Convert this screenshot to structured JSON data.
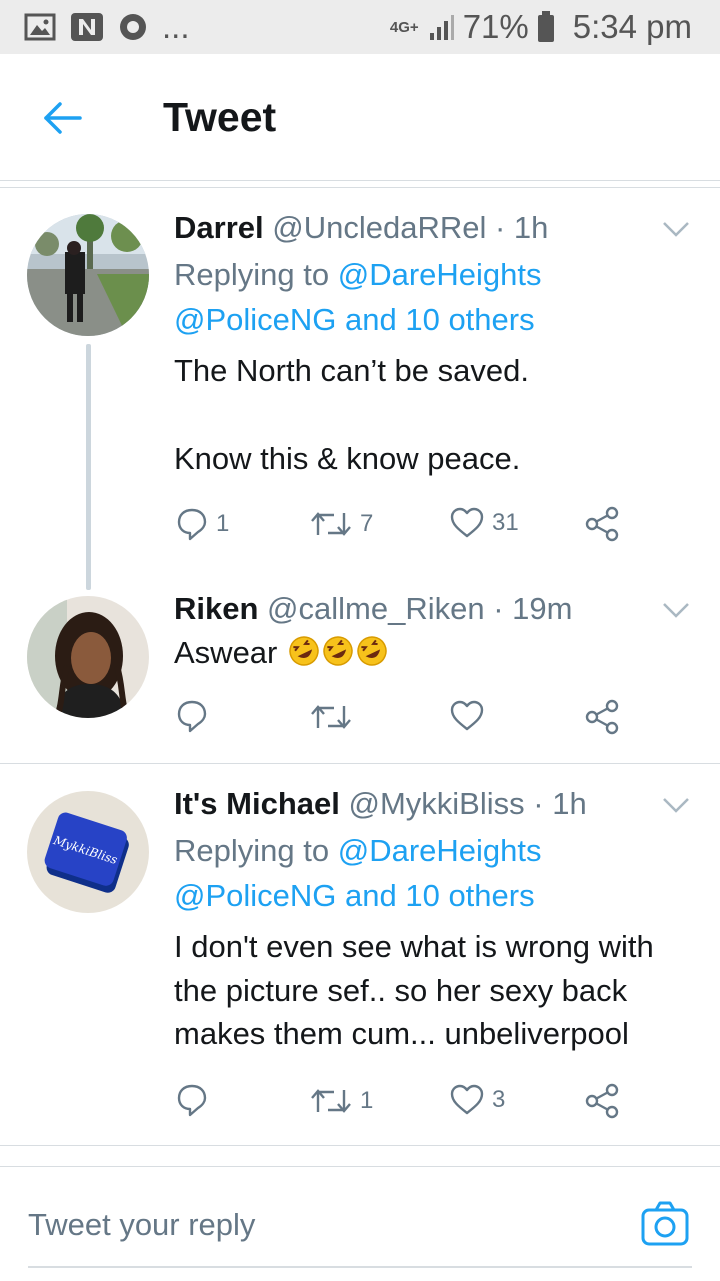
{
  "status_bar": {
    "network": "4G+",
    "battery": "71%",
    "time": "5:34 pm",
    "more": "...",
    "icons": [
      "image-icon",
      "n-app-icon",
      "circle-app-icon",
      "signal-icon",
      "battery-icon"
    ]
  },
  "header": {
    "title": "Tweet",
    "back_icon": "back-arrow-icon"
  },
  "tweets": [
    {
      "name": "Darrel",
      "handle": "@UncledaRRel",
      "time": "· 1h",
      "reply_prefix": "Replying to",
      "reply_to_1": "@DareHeights",
      "reply_to_2": "@PoliceNG and 10 others",
      "text_line_1": "The North can’t be saved.",
      "text_line_2": "Know this & know peace.",
      "replies": "1",
      "retweets": "7",
      "likes": "31"
    },
    {
      "name": "Riken",
      "handle": "@callme_Riken",
      "time": "· 19m",
      "text": "Aswear",
      "emoji": "rolling-on-floor-laughing x3",
      "replies": "",
      "retweets": "",
      "likes": ""
    },
    {
      "name": "It's Michael",
      "handle": "@MykkiBliss",
      "time": "· 1h",
      "reply_prefix": "Replying to",
      "reply_to_1": "@DareHeights",
      "reply_to_2": "@PoliceNG and 10 others",
      "text_line_1": "I don't even see what is wrong with",
      "text_line_2": "the picture sef.. so her sexy back",
      "text_line_3": "makes them cum... unbeliverpool",
      "replies": "",
      "retweets": "1",
      "likes": "3"
    }
  ],
  "reply_bar": {
    "placeholder": "Tweet your reply",
    "camera_icon": "camera-icon"
  },
  "colors": {
    "accent": "#1da1f2",
    "text": "#14171a",
    "secondary": "#657786",
    "divider": "#d8dde1"
  }
}
